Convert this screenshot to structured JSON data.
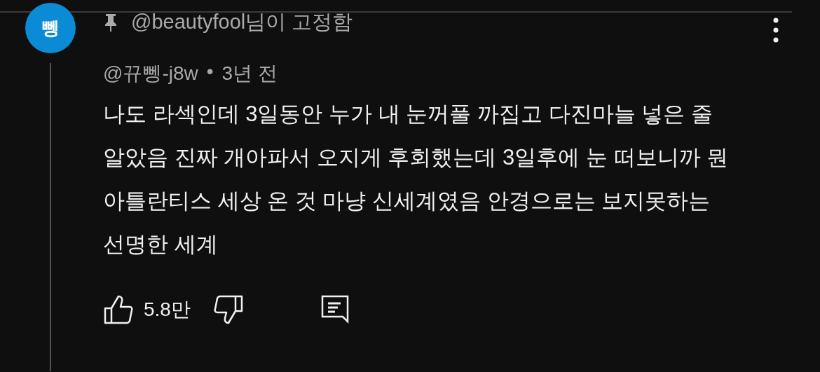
{
  "avatar": {
    "letter": "뼁"
  },
  "pinned": {
    "text": "@beautyfool님이 고정함"
  },
  "comment": {
    "author": "@뀨뼁-j8w",
    "separator": "•",
    "time": "3년 전",
    "text": "나도 라섹인데 3일동안 누가 내 눈꺼풀 까집고 다진마늘 넣은 줄 알았음 진짜 개아파서 오지게 후회했는데 3일후에 눈 떠보니까 뭔 아틀란티스 세상 온 것 마냥 신세계였음 안경으로는 보지못하는 선명한 세계",
    "likes": "5.8만"
  }
}
